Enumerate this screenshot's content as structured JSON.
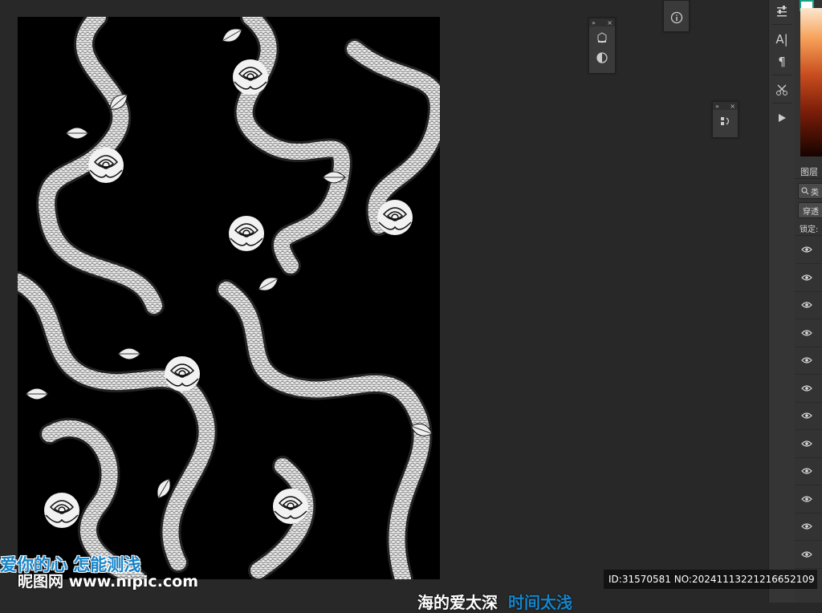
{
  "canvas": {
    "background": "#000000",
    "pattern": "snakes-and-roses"
  },
  "floating_panels": {
    "panel_a": {
      "buttons": [
        "cube-3d-icon",
        "adjust-contrast-icon"
      ]
    },
    "panel_b": {
      "buttons": [
        "swap-icon"
      ]
    },
    "info": {
      "icon": "info-icon"
    }
  },
  "toolstrip": {
    "items": [
      "sliders-icon",
      "character-icon",
      "paragraph-icon",
      "scissors-tool-icon",
      "play-icon"
    ],
    "character_label": "A|",
    "paragraph_label": "¶"
  },
  "layers_panel": {
    "title": "图层",
    "search_placeholder": "类",
    "blend_mode": "穿透",
    "lock_label": "锁定:",
    "rows": 12
  },
  "watermark": {
    "overlay_text": "爱你的心 怎能测浅",
    "brand": "昵图网 www.nipic.com",
    "id_text": "ID:31570581 NO:20241113221216652109",
    "bottom_text_white": "海的爱太深",
    "bottom_text_blue": "时间太浅"
  },
  "colors": {
    "accent": "#16a085",
    "panel_bg": "#333333",
    "workspace_bg": "#282828"
  }
}
